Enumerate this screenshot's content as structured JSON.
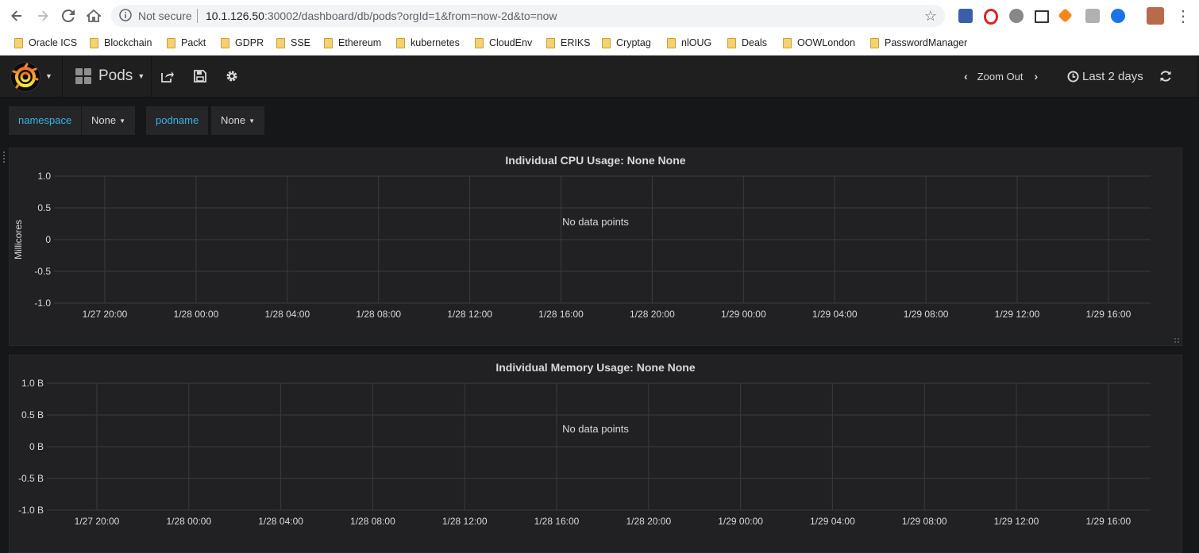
{
  "browser": {
    "security_label": "Not secure",
    "url_host": "10.1.126.50",
    "url_rest": ":30002/dashboard/db/pods?orgId=1&from=now-2d&to=now",
    "bookmarks": [
      "Oracle ICS",
      "Blockchain",
      "Packt",
      "GDPR",
      "SSE",
      "Ethereum",
      "kubernetes",
      "CloudEnv",
      "ERIKS",
      "Cryptag",
      "nlOUG",
      "Deals",
      "OOWLondon",
      "PasswordManager"
    ]
  },
  "grafana": {
    "dashboard_title": "Pods",
    "zoom_label": "Zoom Out",
    "time_range_label": "Last 2 days",
    "variables": [
      {
        "name": "namespace",
        "value": "None"
      },
      {
        "name": "podname",
        "value": "None"
      }
    ],
    "accent_color": "#33b5e5"
  },
  "panels": [
    {
      "title": "Individual CPU Usage: None None",
      "no_data_text": "No data points",
      "y_label": "Millicores",
      "y_ticks": [
        "1.0",
        "0.5",
        "0",
        "-0.5",
        "-1.0"
      ],
      "x_ticks": [
        "1/27 20:00",
        "1/28 00:00",
        "1/28 04:00",
        "1/28 08:00",
        "1/28 12:00",
        "1/28 16:00",
        "1/28 20:00",
        "1/29 00:00",
        "1/29 04:00",
        "1/29 08:00",
        "1/29 12:00",
        "1/29 16:00"
      ]
    },
    {
      "title": "Individual Memory Usage: None None",
      "no_data_text": "No data points",
      "y_label": "",
      "y_ticks": [
        "1.0 B",
        "0.5 B",
        "0 B",
        "-0.5 B",
        "-1.0 B"
      ],
      "x_ticks": [
        "1/27 20:00",
        "1/28 00:00",
        "1/28 04:00",
        "1/28 08:00",
        "1/28 12:00",
        "1/28 16:00",
        "1/28 20:00",
        "1/29 00:00",
        "1/29 04:00",
        "1/29 08:00",
        "1/29 12:00",
        "1/29 16:00"
      ]
    }
  ]
}
